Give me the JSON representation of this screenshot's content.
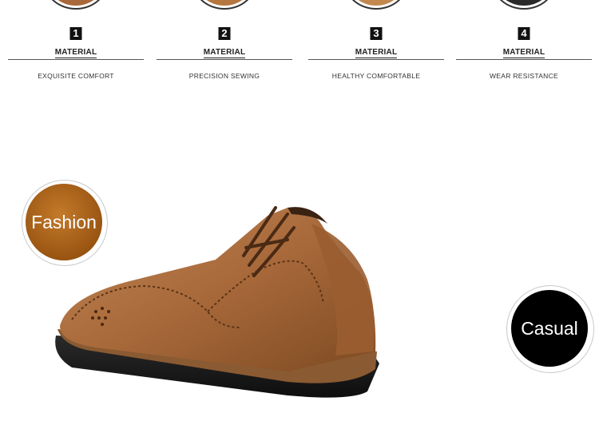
{
  "features": [
    {
      "number": "1",
      "title": "MATERIAL",
      "description": "EXQUISITE COMFORT",
      "thumb_color": "#a8683a"
    },
    {
      "number": "2",
      "title": "MATERIAL",
      "description": "PRECISION SEWING",
      "thumb_color": "#b5773f"
    },
    {
      "number": "3",
      "title": "MATERIAL",
      "description": "HEALTHY  COMFORTABLE",
      "thumb_color": "#c2884e"
    },
    {
      "number": "4",
      "title": "MATERIAL",
      "description": "WEAR RESISTANCE",
      "thumb_color": "#2a2a2a"
    }
  ],
  "badges": {
    "fashion": "Fashion",
    "casual": "Casual"
  },
  "colors": {
    "leather": "#a8693a",
    "sole": "#1a1a1a",
    "fashion_badge": "#9a5512",
    "casual_badge": "#000000"
  }
}
